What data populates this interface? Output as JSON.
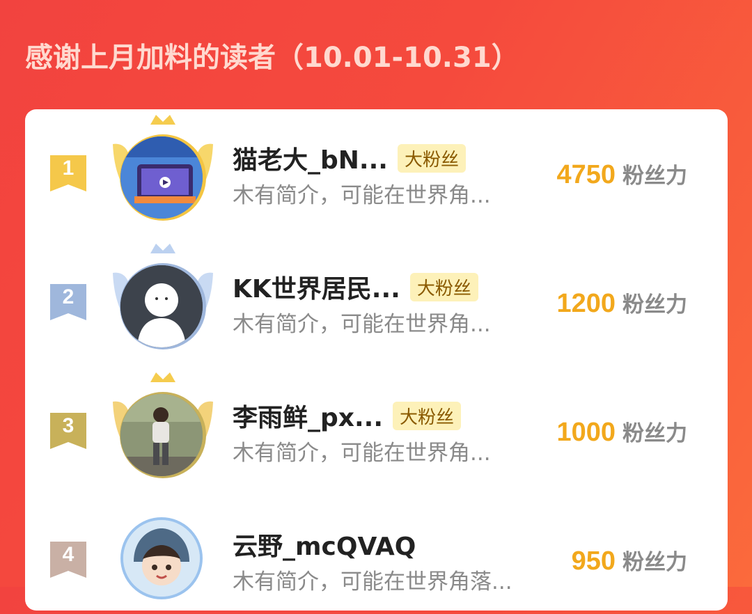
{
  "header": {
    "title": "感谢上月加料的读者（10.01-10.31）"
  },
  "score_unit": "粉丝力",
  "colors": {
    "score": "#f2a81c",
    "gold": "#f4c542",
    "silver": "#9fb7dc",
    "bronze": "#c8b15a",
    "rank4": "#c9b0a5"
  },
  "leaderboard": [
    {
      "rank": "1",
      "name": "猫老大_bN...",
      "badge": "大粉丝",
      "bio": "木有简介，可能在世界角...",
      "score": "4750",
      "frame": "gold"
    },
    {
      "rank": "2",
      "name": "KK世界居民...",
      "badge": "大粉丝",
      "bio": "木有简介，可能在世界角...",
      "score": "1200",
      "frame": "silver"
    },
    {
      "rank": "3",
      "name": "李雨鲜_px...",
      "badge": "大粉丝",
      "bio": "木有简介，可能在世界角...",
      "score": "1000",
      "frame": "bronze"
    },
    {
      "rank": "4",
      "name": "云野_mcQVAQ",
      "badge": "",
      "bio": "木有简介，可能在世界角落...",
      "score": "950",
      "frame": "none"
    }
  ]
}
